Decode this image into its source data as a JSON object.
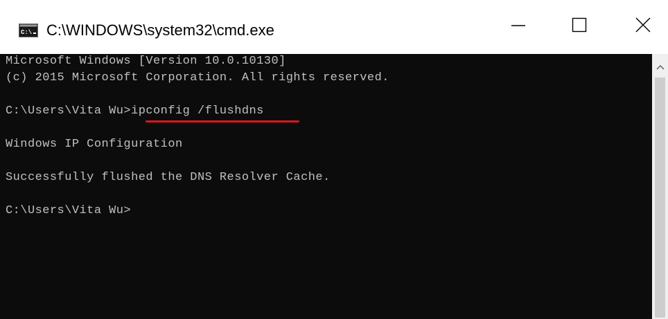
{
  "window": {
    "title": "C:\\WINDOWS\\system32\\cmd.exe",
    "icon": "cmd-icon",
    "controls": {
      "minimize_icon": "minimize-icon",
      "maximize_icon": "maximize-icon",
      "close_icon": "close-icon"
    }
  },
  "console": {
    "background": "#0c0c0c",
    "foreground": "#c0c0c0",
    "lines": [
      "Microsoft Windows [Version 10.0.10130]",
      "(c) 2015 Microsoft Corporation. All rights reserved.",
      "C:\\Users\\Vita Wu>ipconfig /flushdns",
      "Windows IP Configuration",
      "Successfully flushed the DNS Resolver Cache.",
      "C:\\Users\\Vita Wu>"
    ],
    "highlight_color": "#e0141a"
  },
  "scrollbar": {
    "up_icon": "chevron-up-icon"
  }
}
